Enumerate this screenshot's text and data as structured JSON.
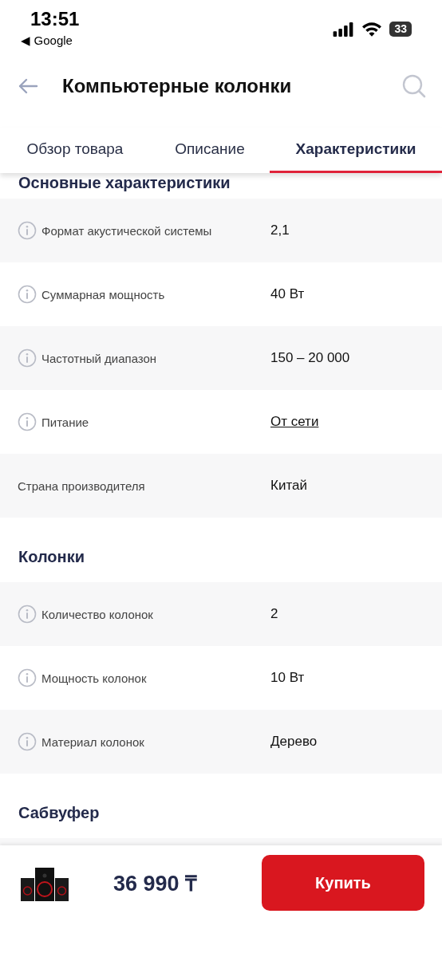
{
  "status_bar": {
    "time": "13:51",
    "back_app": "◀ Google",
    "battery": "33"
  },
  "header": {
    "title": "Компьютерные колонки"
  },
  "tabs": [
    {
      "label": "Обзор товара",
      "selected": false
    },
    {
      "label": "Описание",
      "selected": false
    },
    {
      "label": "Характеристики",
      "selected": true
    }
  ],
  "sections": [
    {
      "title": "Основные характеристики",
      "rows": [
        {
          "kind": "info",
          "name": "Формат акустической системы",
          "value": "2,1"
        },
        {
          "kind": "info",
          "name": "Суммарная мощность",
          "value": "40 Вт"
        },
        {
          "kind": "info",
          "name": "Частотный диапазон",
          "value": "150 – 20 000"
        },
        {
          "kind": "info-link",
          "name": "Питание",
          "value": "От сети"
        },
        {
          "kind": "plain",
          "name": "Страна производителя",
          "value": "Китай"
        }
      ]
    },
    {
      "title": "Колонки",
      "rows": [
        {
          "kind": "info",
          "name": "Количество колонок",
          "value": "2"
        },
        {
          "kind": "info",
          "name": "Мощность колонок",
          "value": "10 Вт"
        },
        {
          "kind": "info",
          "name": "Материал колонок",
          "value": "Дерево"
        }
      ]
    },
    {
      "title": "Сабвуфер"
    }
  ],
  "bottom_bar": {
    "price": "36 990 ₸",
    "buy_button": "Купить"
  }
}
